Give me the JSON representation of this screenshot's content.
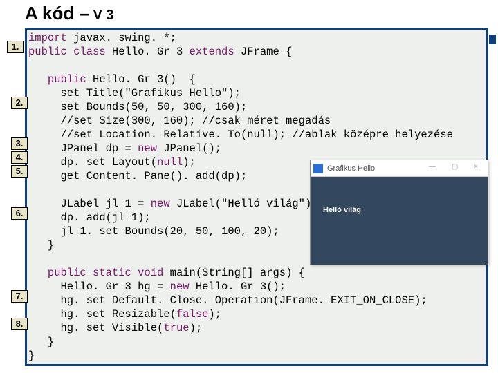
{
  "title_main": "A kód –",
  "title_sub": " V 3",
  "code": {
    "l1a": "import",
    "l1b": " javax. swing. *;",
    "l2a": "public class",
    "l2b": " Hello. Gr 3 ",
    "l2c": "extends",
    "l2d": " JFrame {",
    "l3a": "   public",
    "l3b": " Hello. Gr 3()  {",
    "l4": "     set Title(\"Grafikus Hello\");",
    "l5": "     set Bounds(50, 50, 300, 160);",
    "l6": "     //set Size(300, 160); //csak méret megadás",
    "l7": "     //set Location. Relative. To(null); //ablak középre helyezése",
    "l8": "     JPanel dp = ",
    "l8b": "new",
    "l8c": " JPanel();",
    "l9": "     dp. set Layout(",
    "l9b": "null",
    "l9c": ");",
    "l10": "     get Content. Pane(). add(dp);",
    "l11": "     JLabel jl 1 = ",
    "l11b": "new",
    "l11c": " JLabel(\"Helló világ\");",
    "l12": "     dp. add(jl 1);",
    "l13": "     jl 1. set Bounds(20, 50, 100, 20);",
    "l14": "   }",
    "l15a": "   public static void",
    "l15b": " main(String[] args) {",
    "l16": "     Hello. Gr 3 hg = ",
    "l16b": "new",
    "l16c": " Hello. Gr 3();",
    "l17": "     hg. set Default. Close. Operation(JFrame. EXIT_ON_CLOSE);",
    "l18": "     hg. set Resizable(",
    "l18b": "false",
    "l18c": ");",
    "l19": "     hg. set Visible(",
    "l19b": "true",
    "l19c": ");",
    "l20": "   }",
    "l21": "}"
  },
  "nums": {
    "n1": "1.",
    "n2": "2.",
    "n3": "3.",
    "n4": "4.",
    "n5": "5.",
    "n6": "6.",
    "n7": "7.",
    "n8": "8."
  },
  "window": {
    "title": "Grafikus Hello",
    "label": "Helló világ",
    "buttons": "— ▢ ×"
  }
}
